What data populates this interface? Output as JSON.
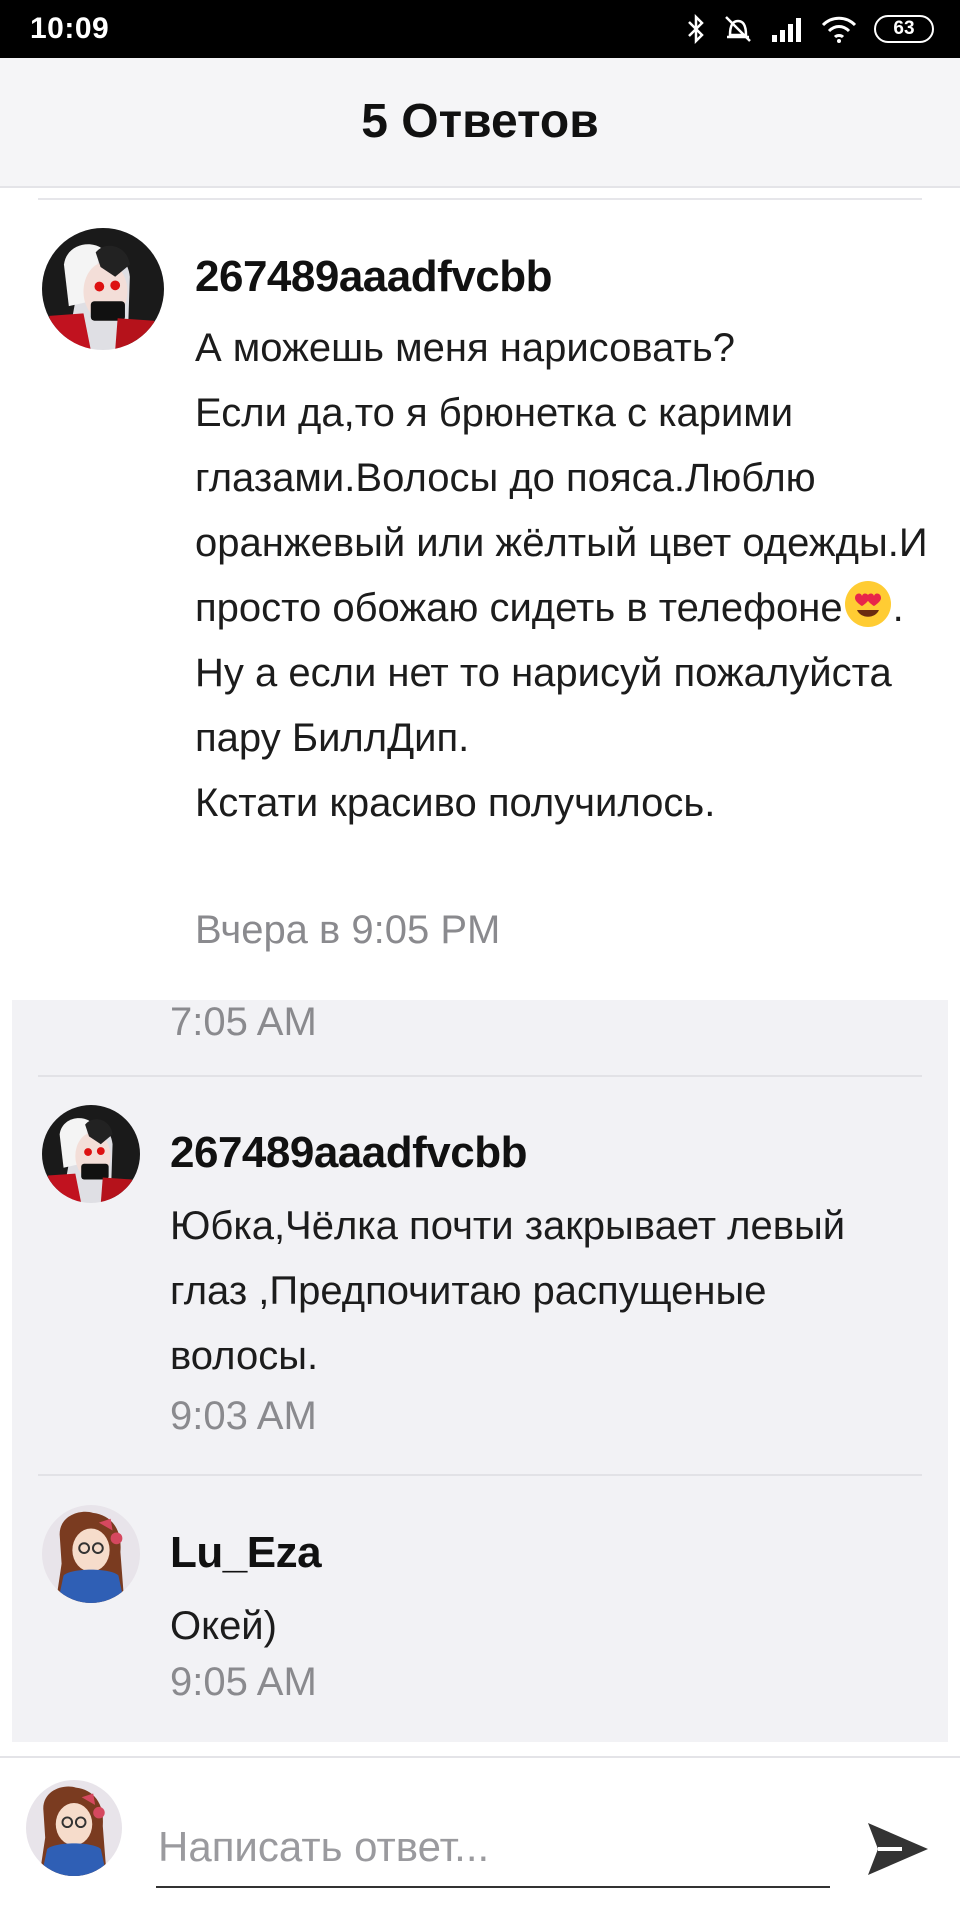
{
  "status_bar": {
    "time": "10:09",
    "battery": "63",
    "icons": [
      "bluetooth-icon",
      "alarm-off-icon",
      "signal-icon",
      "wifi-icon",
      "battery-icon"
    ]
  },
  "header": {
    "title": "5 Ответов"
  },
  "main_comment": {
    "username": "267489aaadfvcbb",
    "text_before_emoji": "А можешь меня нарисовать?\nЕсли да,то я брюнетка с карими глазами.Волосы до пояса.Люблю оранжевый или жёлтый цвет одежды.И просто обожаю сидеть в телефоне",
    "emoji": "heart-eyes-emoji",
    "text_after_emoji": ".\nНу а если нет то нарисуй пожалуйста пару БиллДип.\nКстати красиво получилось.",
    "time": "Вчера в 9:05 PM"
  },
  "replies": [
    {
      "time": "7:05 AM"
    },
    {
      "username": "267489aaadfvcbb",
      "text": "Юбка,Чёлка почти закрывает левый глаз ,Предпочитаю распущеные волосы.",
      "time": "9:03 AM"
    },
    {
      "username": "Lu_Eza",
      "text": "Окей)",
      "time": "9:05 AM"
    }
  ],
  "footer": {
    "placeholder": "Написать ответ...",
    "send_icon": "send-icon"
  },
  "colors": {
    "status_bar": "#000000",
    "header_bg": "#f5f5f7",
    "replies_bg": "#f2f2f5",
    "timestamp": "#8a8a8e",
    "text": "#1c1c1c"
  }
}
